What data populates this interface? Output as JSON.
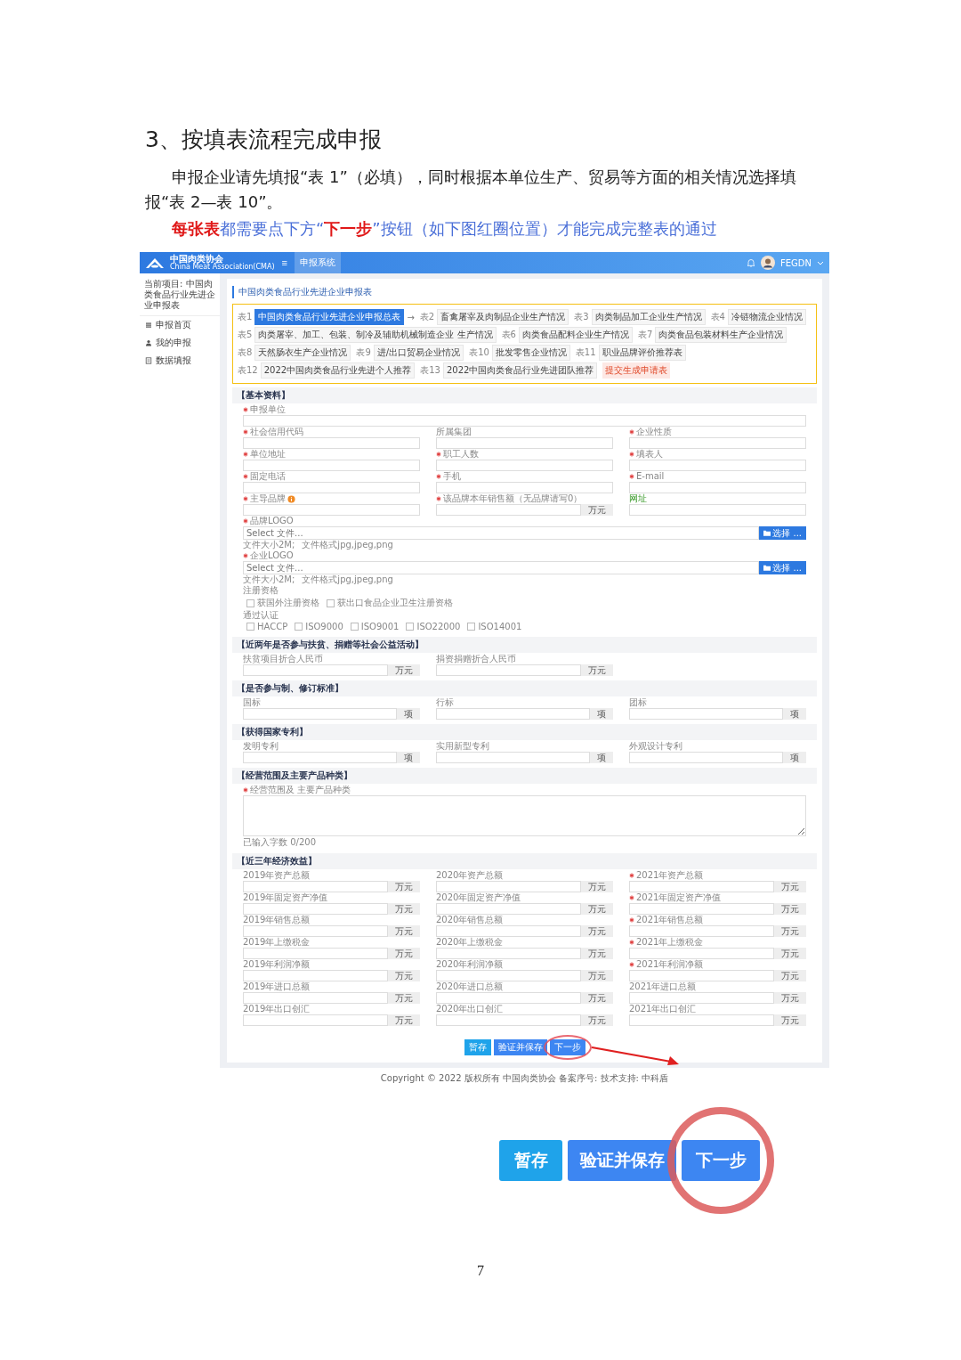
{
  "document": {
    "heading": "3、按填表流程完成申报",
    "paragraph": "申报企业请先填报“表 1”（必填），同时根据本单位生产、贸易等方面的相关情况选择填报“表 2—表 10”。",
    "note": "**每张表**都需要点下方“**下一步**”按钮（如下图红圈位置）才能完成完整表的通过"
  },
  "app": {
    "header": {
      "logo_text": "中国肉类协会",
      "logo_subtext": "China Meat Association(CMA)",
      "menu_glyph": "≡",
      "nav_tab": "申报系统",
      "user": "FEGDN"
    },
    "sidebar": {
      "project": "当前项目: 中国肉类食品行业先进企业申报表",
      "items": [
        {
          "label": "申报首页",
          "kind": "list"
        },
        {
          "label": "我的申报",
          "kind": "person"
        },
        {
          "label": "数据填报",
          "kind": "doc"
        }
      ]
    },
    "form_title": "中国肉类食品行业先进企业申报表",
    "tables_highlighted": true,
    "tables_arrow": "→",
    "tables": [
      {
        "num": "表1",
        "label": "中国肉类食品行业先进企业申报总表",
        "selected": true
      },
      {
        "num": "表2",
        "label": "畜禽屠宰及肉制品企业生产情况",
        "selected": false
      },
      {
        "num": "表3",
        "label": "肉类制品加工企业生产情况",
        "selected": false
      },
      {
        "num": "表4",
        "label": "冷链物流企业情况",
        "selected": false
      },
      {
        "num": "表5",
        "label": "肉类屠宰、加工、包装、制冷及辅助机械制造企业 生产情况",
        "selected": false
      },
      {
        "num": "表6",
        "label": "肉类食品配料企业生产情况",
        "selected": false
      },
      {
        "num": "表7",
        "label": "肉类食品包装材料生产企业情况",
        "selected": false
      },
      {
        "num": "表8",
        "label": "天然肠衣生产企业情况",
        "selected": false
      },
      {
        "num": "表9",
        "label": "进/出口贸易企业情况",
        "selected": false
      },
      {
        "num": "表10",
        "label": "批发零售企业情况",
        "selected": false
      },
      {
        "num": "表11",
        "label": "职业品牌评价推荐表",
        "selected": false
      },
      {
        "num": "表12",
        "label": "2022中国肉类食品行业先进个人推荐",
        "selected": false
      },
      {
        "num": "表13",
        "label": "2022中国肉类食品行业先进团队推荐",
        "selected": false
      }
    ],
    "submit_tag": "提交生成申请表",
    "sections": [
      {
        "title": "【基本资料】",
        "fields": [
          {
            "kind": "wide",
            "label": "申报单位",
            "required": true
          },
          {
            "kind": "text",
            "label": "社会信用代码",
            "required": true
          },
          {
            "kind": "text",
            "label": "所属集团",
            "required": false
          },
          {
            "kind": "text",
            "label": "企业性质",
            "required": true
          },
          {
            "kind": "text",
            "label": "单位地址",
            "required": true
          },
          {
            "kind": "text",
            "label": "职工人数",
            "required": true
          },
          {
            "kind": "text",
            "label": "填表人",
            "required": true
          },
          {
            "kind": "text",
            "label": "固定电话",
            "required": true
          },
          {
            "kind": "text",
            "label": "手机",
            "required": true
          },
          {
            "kind": "text",
            "label": "E-mail",
            "required": true
          },
          {
            "kind": "text",
            "label": "主导品牌",
            "required": true,
            "info": true
          },
          {
            "kind": "unit",
            "label": "该品牌本年销售额（无品牌请写0）",
            "required": true,
            "unit": "万元"
          },
          {
            "kind": "text",
            "label": "网址",
            "required": false,
            "accent": true
          },
          {
            "kind": "file",
            "label": "品牌LOGO",
            "required": true,
            "placeholder": "Select 文件...",
            "button": "选择 ...",
            "hint": [
              "文件大小2M;",
              "文件格式jpg,jpeg,png"
            ]
          },
          {
            "kind": "file",
            "label": "企业LOGO",
            "required": true,
            "placeholder": "Select 文件...",
            "button": "选择 ...",
            "hint": [
              "文件大小2M;",
              "文件格式jpg,jpeg,png"
            ]
          },
          {
            "kind": "checks",
            "label": "注册资格",
            "required": false,
            "options": [
              {
                "label": "获国外注册资格",
                "checked": false
              },
              {
                "label": "获出口食品企业卫生注册资格",
                "checked": false
              }
            ]
          },
          {
            "kind": "checks",
            "label": "通过认证",
            "required": false,
            "options": [
              {
                "label": "HACCP",
                "checked": false
              },
              {
                "label": "ISO9000",
                "checked": false
              },
              {
                "label": "ISO9001",
                "checked": false
              },
              {
                "label": "ISO22000",
                "checked": false
              },
              {
                "label": "ISO14001",
                "checked": false
              }
            ]
          }
        ]
      },
      {
        "title": "【近两年是否参与扶贫、捐赠等社会公益活动】",
        "fields": [
          {
            "kind": "unit",
            "label": "扶贫项目折合人民币",
            "required": false,
            "unit": "万元"
          },
          {
            "kind": "unit",
            "label": "捐资捐赠折合人民币",
            "required": false,
            "unit": "万元"
          }
        ]
      },
      {
        "title": "【是否参与制、修订标准】",
        "fields": [
          {
            "kind": "unit",
            "label": "国标",
            "required": false,
            "unit": "项"
          },
          {
            "kind": "unit",
            "label": "行标",
            "required": false,
            "unit": "项"
          },
          {
            "kind": "unit",
            "label": "团标",
            "required": false,
            "unit": "项"
          }
        ]
      },
      {
        "title": "【获得国家专利】",
        "fields": [
          {
            "kind": "unit",
            "label": "发明专利",
            "required": false,
            "unit": "项"
          },
          {
            "kind": "unit",
            "label": "实用新型专利",
            "required": false,
            "unit": "项"
          },
          {
            "kind": "unit",
            "label": "外观设计专利",
            "required": false,
            "unit": "项"
          }
        ]
      },
      {
        "title": "【经营范围及主要产品种类】",
        "fields": [
          {
            "kind": "textarea",
            "label": "经营范围及 主要产品种类",
            "required": true,
            "counter": "已输入字数 0/200"
          }
        ]
      },
      {
        "title": "【近三年经济效益】",
        "fields": [
          {
            "kind": "unit",
            "label": "2019年资产总额",
            "required": false,
            "unit": "万元"
          },
          {
            "kind": "unit",
            "label": "2020年资产总额",
            "required": false,
            "unit": "万元"
          },
          {
            "kind": "unit",
            "label": "2021年资产总额",
            "required": true,
            "unit": "万元"
          },
          {
            "kind": "unit",
            "label": "2019年固定资产净值",
            "required": false,
            "unit": "万元"
          },
          {
            "kind": "unit",
            "label": "2020年固定资产净值",
            "required": false,
            "unit": "万元"
          },
          {
            "kind": "unit",
            "label": "2021年固定资产净值",
            "required": true,
            "unit": "万元"
          },
          {
            "kind": "unit",
            "label": "2019年销售总额",
            "required": false,
            "unit": "万元"
          },
          {
            "kind": "unit",
            "label": "2020年销售总额",
            "required": false,
            "unit": "万元"
          },
          {
            "kind": "unit",
            "label": "2021年销售总额",
            "required": true,
            "unit": "万元"
          },
          {
            "kind": "unit",
            "label": "2019年上缴税金",
            "required": false,
            "unit": "万元"
          },
          {
            "kind": "unit",
            "label": "2020年上缴税金",
            "required": false,
            "unit": "万元"
          },
          {
            "kind": "unit",
            "label": "2021年上缴税金",
            "required": true,
            "unit": "万元"
          },
          {
            "kind": "unit",
            "label": "2019年利润净额",
            "required": false,
            "unit": "万元"
          },
          {
            "kind": "unit",
            "label": "2020年利润净额",
            "required": false,
            "unit": "万元"
          },
          {
            "kind": "unit",
            "label": "2021年利润净额",
            "required": true,
            "unit": "万元"
          },
          {
            "kind": "unit",
            "label": "2019年进口总额",
            "required": false,
            "unit": "万元"
          },
          {
            "kind": "unit",
            "label": "2020年进口总额",
            "required": false,
            "unit": "万元"
          },
          {
            "kind": "unit",
            "label": "2021年进口总额",
            "required": false,
            "unit": "万元"
          },
          {
            "kind": "unit",
            "label": "2019年出口创汇",
            "required": false,
            "unit": "万元"
          },
          {
            "kind": "unit",
            "label": "2020年出口创汇",
            "required": false,
            "unit": "万元"
          },
          {
            "kind": "unit",
            "label": "2021年出口创汇",
            "required": false,
            "unit": "万元"
          }
        ]
      }
    ],
    "buttons": [
      {
        "label": "暂存",
        "kind": "save",
        "circled": false
      },
      {
        "label": "验证并保存",
        "kind": "verify",
        "circled": false
      },
      {
        "label": "下一步",
        "kind": "next",
        "circled": true
      }
    ],
    "copyright": "Copyright © 2022 版权所有 中国肉类协会 备案序号:  技术支持: 中科盾"
  },
  "zoomed_buttons": [
    {
      "label": "暂存",
      "kind": "save",
      "circled": false
    },
    {
      "label": "验证并保存",
      "kind": "verify",
      "circled": false
    },
    {
      "label": "下一步",
      "kind": "next",
      "circled": true
    }
  ],
  "page_number": "7"
}
